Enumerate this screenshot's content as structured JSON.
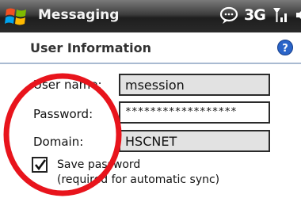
{
  "titlebar": {
    "app_title": "Messaging",
    "icons": [
      "windows-start-icon",
      "chat-bubble-icon",
      "signal-strength-icon",
      "volume-icon"
    ],
    "network_label": "3G"
  },
  "section": {
    "title": "User Information",
    "help_icon": "help-icon"
  },
  "form": {
    "username_label": "User name:",
    "username_value": "msession",
    "password_label": "Password:",
    "password_value": "******************",
    "domain_label": "Domain:",
    "domain_value": "HSCNET",
    "save_password_checked": true,
    "save_password_label_line1": "Save password",
    "save_password_label_line2": "(required for automatic sync)"
  },
  "colors": {
    "annotation_ring": "#e8141c",
    "help_icon": "#2a64c8",
    "header_rule": "#a9bad1"
  }
}
